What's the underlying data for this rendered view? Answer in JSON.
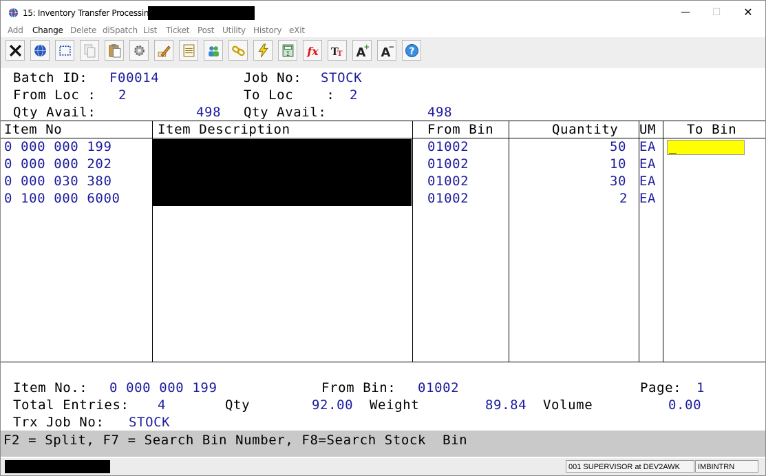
{
  "window": {
    "title": "15: Inventory Transfer Processing -",
    "controls": {
      "minimize": "—",
      "maximize": "☐",
      "close": "✕"
    }
  },
  "menu": [
    "Add",
    "Change",
    "Delete",
    "diSpatch",
    "List",
    "Ticket",
    "Post",
    "Utility",
    "History",
    "eXit"
  ],
  "menu_active": "Change",
  "toolbar_icons": [
    "close-x-icon",
    "globe-icon",
    "select-rect-icon",
    "copy-icon",
    "paste-icon",
    "gear-icon",
    "edit-pencil-icon",
    "notepad-icon",
    "users-icon",
    "link-chain-icon",
    "lightning-icon",
    "calculator-icon",
    "fx-function-icon",
    "font-size-icon",
    "increase-font-icon",
    "decrease-font-icon",
    "help-icon"
  ],
  "header": {
    "batch_label": "Batch ID:",
    "batch_value": "F00014",
    "job_label": "Job No:",
    "job_value": "STOCK",
    "from_loc_label": "From Loc :",
    "from_loc_value": "2",
    "to_loc_label": "To Loc    :",
    "to_loc_value": "2",
    "qty_avail_label_1": "Qty Avail:",
    "qty_avail_value_1": "498",
    "qty_avail_label_2": "Qty Avail:",
    "qty_avail_value_2": "498"
  },
  "table": {
    "columns": {
      "item_no": "Item No",
      "description": "Item Description",
      "from_bin": "From Bin",
      "quantity": "Quantity",
      "um": "UM",
      "to_bin": "To Bin"
    },
    "rows": [
      {
        "item_no": "0 000 000 199",
        "from_bin": "01002",
        "quantity": "50",
        "um": "EA"
      },
      {
        "item_no": "0 000 000 202",
        "from_bin": "01002",
        "quantity": "10",
        "um": "EA"
      },
      {
        "item_no": "0 000 030 380",
        "from_bin": "01002",
        "quantity": "30",
        "um": "EA"
      },
      {
        "item_no": "0 100 000 6000",
        "from_bin": "01002",
        "quantity": "2",
        "um": "EA"
      }
    ],
    "to_bin_input_value": "_"
  },
  "footer": {
    "item_no_label": "Item No.:",
    "item_no_value": "0 000 000 199",
    "from_bin_label": "From Bin:",
    "from_bin_value": "01002",
    "page_label": "Page:",
    "page_value": "1",
    "total_entries_label": "Total Entries:",
    "total_entries_value": "4",
    "qty_label": "Qty",
    "qty_value": "92.00",
    "weight_label": "Weight",
    "weight_value": "89.84",
    "volume_label": "Volume",
    "volume_value": "0.00",
    "trx_job_label": "Trx Job No:",
    "trx_job_value": "STOCK"
  },
  "function_keys": "F2 = Split, F7 = Search Bin Number, F8=Search Stock  Bin",
  "status": {
    "user": "001 SUPERVISOR at DEV2AWK",
    "program": "IMBINTRN"
  },
  "colors": {
    "value_text": "#1c1c9e",
    "input_highlight": "#ffff00",
    "function_bar": "#c9c9c9"
  }
}
